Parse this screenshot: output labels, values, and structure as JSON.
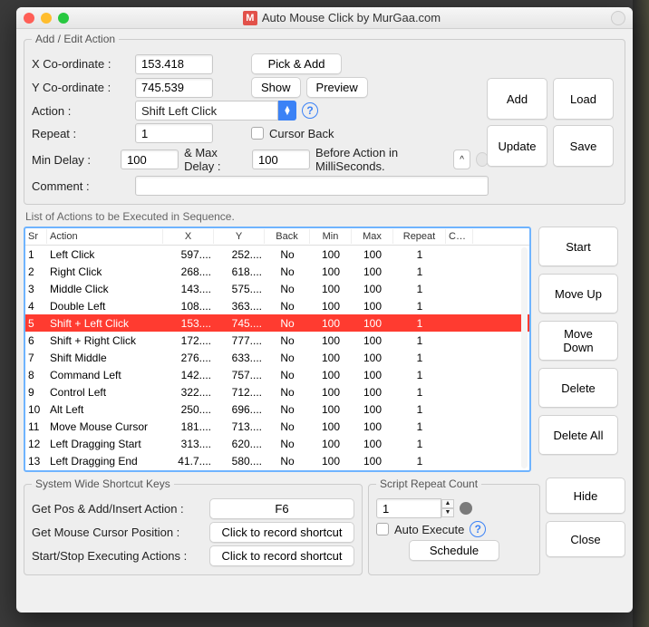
{
  "window": {
    "title": "Auto Mouse Click by MurGaa.com",
    "badge": "M"
  },
  "addEdit": {
    "legend": "Add / Edit Action",
    "xLabel": "X Co-ordinate :",
    "xVal": "153.418",
    "yLabel": "Y Co-ordinate :",
    "yVal": "745.539",
    "actionLabel": "Action :",
    "actionVal": "Shift Left Click",
    "repeatLabel": "Repeat :",
    "repeatVal": "1",
    "cursorBack": "Cursor Back",
    "minDelayLabel": "Min Delay :",
    "minDelayVal": "100",
    "maxDelayLabel": "& Max Delay :",
    "maxDelayVal": "100",
    "delaySuffix": "Before Action in MilliSeconds.",
    "commentLabel": "Comment :",
    "pickAdd": "Pick & Add",
    "show": "Show",
    "preview": "Preview",
    "add": "Add",
    "load": "Load",
    "update": "Update",
    "save": "Save"
  },
  "listLabel": "List of Actions to be Executed in Sequence.",
  "cols": {
    "sr": "Sr",
    "action": "Action",
    "x": "X",
    "y": "Y",
    "back": "Back",
    "min": "Min",
    "max": "Max",
    "repeat": "Repeat",
    "c": "C…"
  },
  "rows": [
    {
      "sr": "1",
      "action": "Left Click",
      "x": "597....",
      "y": "252....",
      "back": "No",
      "min": "100",
      "max": "100",
      "repeat": "1",
      "sel": false
    },
    {
      "sr": "2",
      "action": "Right Click",
      "x": "268....",
      "y": "618....",
      "back": "No",
      "min": "100",
      "max": "100",
      "repeat": "1",
      "sel": false
    },
    {
      "sr": "3",
      "action": "Middle Click",
      "x": "143....",
      "y": "575....",
      "back": "No",
      "min": "100",
      "max": "100",
      "repeat": "1",
      "sel": false
    },
    {
      "sr": "4",
      "action": "Double Left",
      "x": "108....",
      "y": "363....",
      "back": "No",
      "min": "100",
      "max": "100",
      "repeat": "1",
      "sel": false
    },
    {
      "sr": "5",
      "action": "Shift + Left Click",
      "x": "153....",
      "y": "745....",
      "back": "No",
      "min": "100",
      "max": "100",
      "repeat": "1",
      "sel": true
    },
    {
      "sr": "6",
      "action": "Shift + Right Click",
      "x": "172....",
      "y": "777....",
      "back": "No",
      "min": "100",
      "max": "100",
      "repeat": "1",
      "sel": false
    },
    {
      "sr": "7",
      "action": "Shift Middle",
      "x": "276....",
      "y": "633....",
      "back": "No",
      "min": "100",
      "max": "100",
      "repeat": "1",
      "sel": false
    },
    {
      "sr": "8",
      "action": "Command Left",
      "x": "142....",
      "y": "757....",
      "back": "No",
      "min": "100",
      "max": "100",
      "repeat": "1",
      "sel": false
    },
    {
      "sr": "9",
      "action": "Control Left",
      "x": "322....",
      "y": "712....",
      "back": "No",
      "min": "100",
      "max": "100",
      "repeat": "1",
      "sel": false
    },
    {
      "sr": "10",
      "action": "Alt Left",
      "x": "250....",
      "y": "696....",
      "back": "No",
      "min": "100",
      "max": "100",
      "repeat": "1",
      "sel": false
    },
    {
      "sr": "11",
      "action": "Move Mouse Cursor",
      "x": "181....",
      "y": "713....",
      "back": "No",
      "min": "100",
      "max": "100",
      "repeat": "1",
      "sel": false
    },
    {
      "sr": "12",
      "action": "Left Dragging Start",
      "x": "313....",
      "y": "620....",
      "back": "No",
      "min": "100",
      "max": "100",
      "repeat": "1",
      "sel": false
    },
    {
      "sr": "13",
      "action": "Left Dragging End",
      "x": "41.7....",
      "y": "580....",
      "back": "No",
      "min": "100",
      "max": "100",
      "repeat": "1",
      "sel": false
    }
  ],
  "side": {
    "start": "Start",
    "moveUp": "Move Up",
    "moveDown": "Move Down",
    "delete": "Delete",
    "deleteAll": "Delete All"
  },
  "shortcuts": {
    "legend": "System Wide Shortcut Keys",
    "getPosLabel": "Get Pos & Add/Insert Action :",
    "getPosBtn": "F6",
    "getCursorLabel": "Get Mouse Cursor Position :",
    "getCursorBtn": "Click to record shortcut",
    "startStopLabel": "Start/Stop Executing Actions :",
    "startStopBtn": "Click to record shortcut"
  },
  "repeat": {
    "legend": "Script Repeat Count",
    "val": "1",
    "autoExec": "Auto Execute",
    "schedule": "Schedule"
  },
  "hide": "Hide",
  "close": "Close"
}
